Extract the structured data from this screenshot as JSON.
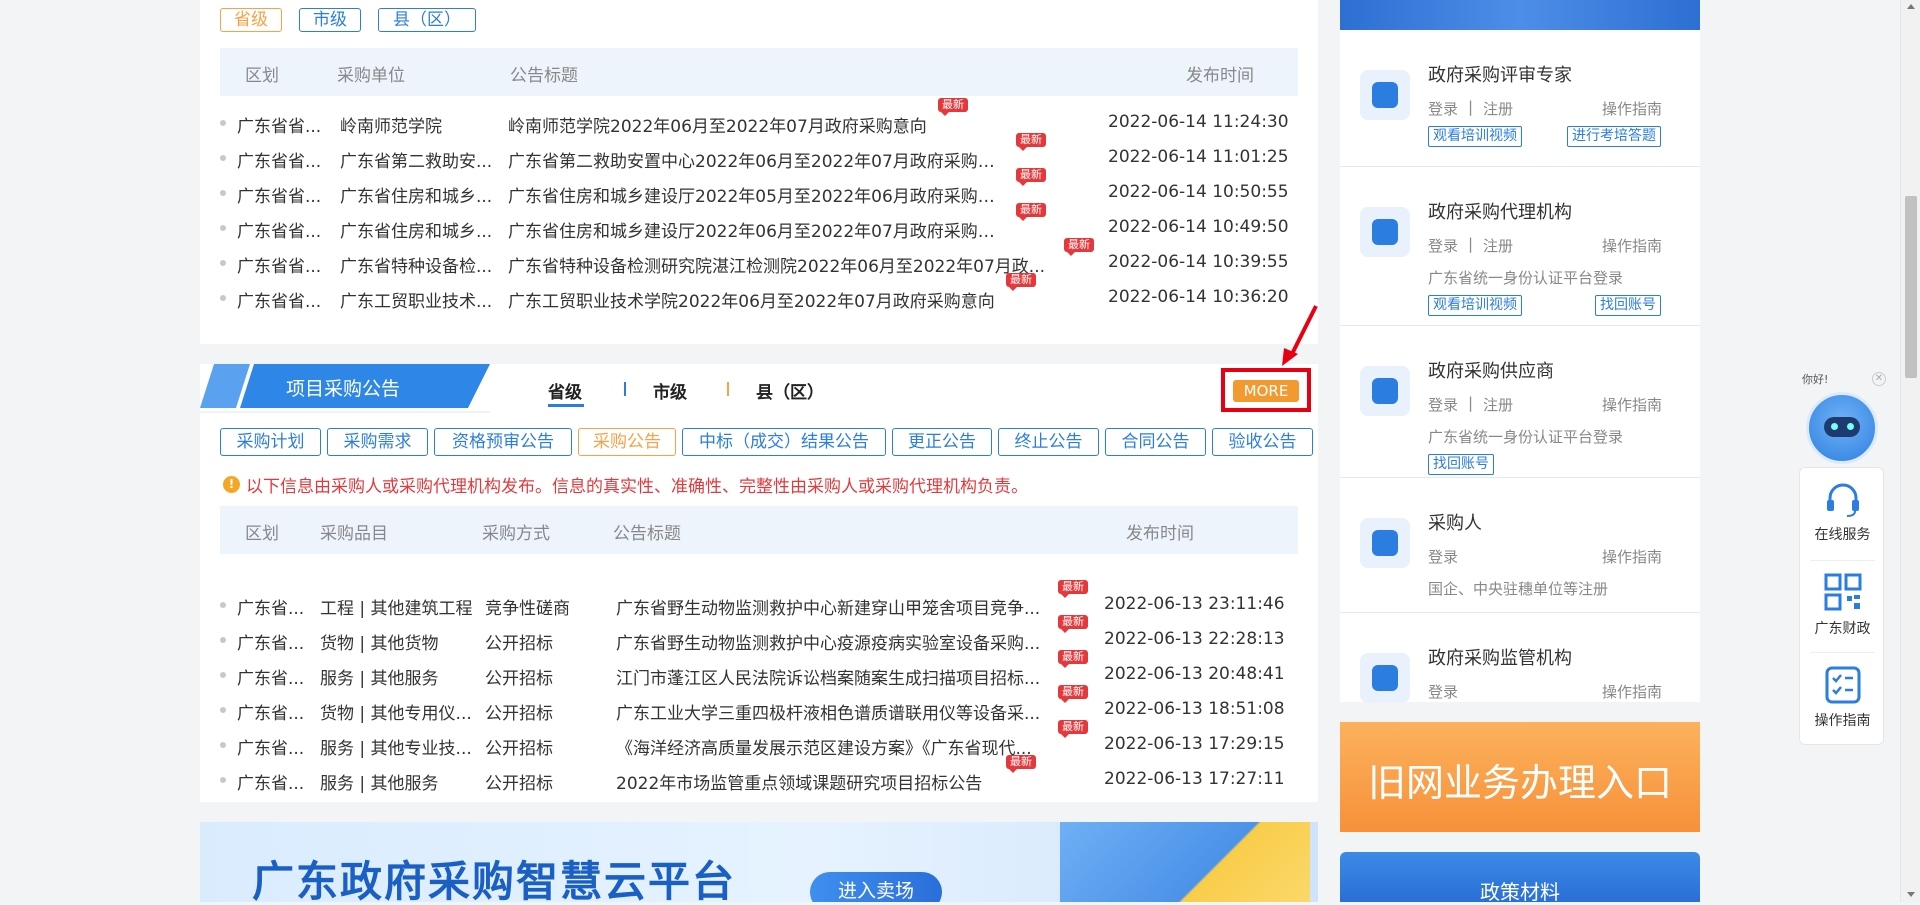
{
  "top_section": {
    "level_tabs": [
      "省级",
      "市级",
      "县（区）"
    ],
    "headers": [
      "区划",
      "采购单位",
      "公告标题",
      "发布时间"
    ],
    "rows": [
      {
        "region": "广东省省...",
        "unit": "岭南师范学院",
        "title": "岭南师范学院2022年06月至2022年07月政府采购意向",
        "badge": "最新",
        "time": "2022-06-14 11:24:30"
      },
      {
        "region": "广东省省...",
        "unit": "广东省第二救助安...",
        "title": "广东省第二救助安置中心2022年06月至2022年07月政府采购意向",
        "badge": "最新",
        "time": "2022-06-14 11:01:25"
      },
      {
        "region": "广东省省...",
        "unit": "广东省住房和城乡...",
        "title": "广东省住房和城乡建设厅2022年05月至2022年06月政府采购意向",
        "badge": "最新",
        "time": "2022-06-14 10:50:55"
      },
      {
        "region": "广东省省...",
        "unit": "广东省住房和城乡...",
        "title": "广东省住房和城乡建设厅2022年06月至2022年07月政府采购意向",
        "badge": "最新",
        "time": "2022-06-14 10:49:50"
      },
      {
        "region": "广东省省...",
        "unit": "广东省特种设备检...",
        "title": "广东省特种设备检测研究院湛江检测院2022年06月至2022年07月政...",
        "badge": "最新",
        "time": "2022-06-14 10:39:55"
      },
      {
        "region": "广东省省...",
        "unit": "广东工贸职业技术...",
        "title": "广东工贸职业技术学院2022年06月至2022年07月政府采购意向",
        "badge": "最新",
        "time": "2022-06-14 10:36:20"
      }
    ]
  },
  "project_section": {
    "title": "项目采购公告",
    "level_tabs": [
      "省级",
      "市级",
      "县（区）"
    ],
    "more_label": "MORE",
    "type_tabs": [
      "采购计划",
      "采购需求",
      "资格预审公告",
      "采购公告",
      "中标（成交）结果公告",
      "更正公告",
      "终止公告",
      "合同公告",
      "验收公告"
    ],
    "notice": "以下信息由采购人或采购代理机构发布。信息的真实性、准确性、完整性由采购人或采购代理机构负责。",
    "headers": [
      "区划",
      "采购品目",
      "采购方式",
      "公告标题",
      "发布时间"
    ],
    "rows": [
      {
        "region": "广东省...",
        "item": "工程 | 其他建筑工程",
        "method": "竞争性磋商",
        "title": "广东省野生动物监测救护中心新建穿山甲笼舍项目竞争...",
        "badge": "最新",
        "time": "2022-06-13 23:11:46"
      },
      {
        "region": "广东省...",
        "item": "货物 | 其他货物",
        "method": "公开招标",
        "title": "广东省野生动物监测救护中心疫源疫病实验室设备采购...",
        "badge": "最新",
        "time": "2022-06-13 22:28:13"
      },
      {
        "region": "广东省...",
        "item": "服务 | 其他服务",
        "method": "公开招标",
        "title": "江门市蓬江区人民法院诉讼档案随案生成扫描项目招标...",
        "badge": "最新",
        "time": "2022-06-13 20:48:41"
      },
      {
        "region": "广东省...",
        "item": "货物 | 其他专用仪...",
        "method": "公开招标",
        "title": "广东工业大学三重四极杆液相色谱质谱联用仪等设备采...",
        "badge": "最新",
        "time": "2022-06-13 18:51:08"
      },
      {
        "region": "广东省...",
        "item": "服务 | 其他专业技...",
        "method": "公开招标",
        "title": "《海洋经济高质量发展示范区建设方案》《广东省现代...",
        "badge": "最新",
        "time": "2022-06-13 17:29:15"
      },
      {
        "region": "广东省...",
        "item": "服务 | 其他服务",
        "method": "公开招标",
        "title": "2022年市场监管重点领域课题研究项目招标公告",
        "badge": "最新",
        "time": "2022-06-13 17:27:11"
      }
    ]
  },
  "banner": {
    "title": "广东政府采购智慧云平台",
    "button": "进入卖场"
  },
  "sidebar": {
    "cards": [
      {
        "title": "政府采购评审专家",
        "login": "登录",
        "register": "注册",
        "guide": "操作指南",
        "note": "",
        "buttons": [
          "观看培训视频",
          "进行考培答题"
        ]
      },
      {
        "title": "政府采购代理机构",
        "login": "登录",
        "register": "注册",
        "guide": "操作指南",
        "note": "广东省统一身份认证平台登录",
        "buttons": [
          "观看培训视频",
          "找回账号"
        ]
      },
      {
        "title": "政府采购供应商",
        "login": "登录",
        "register": "注册",
        "guide": "操作指南",
        "note": "广东省统一身份认证平台登录",
        "buttons": [
          "找回账号"
        ]
      },
      {
        "title": "采购人",
        "login": "登录",
        "register": "",
        "guide": "操作指南",
        "note": "国企、中央驻穗单位等注册",
        "buttons": []
      },
      {
        "title": "政府采购监管机构",
        "login": "登录",
        "register": "",
        "guide": "操作指南",
        "note": "",
        "buttons": []
      }
    ],
    "old_portal": "旧网业务办理入口",
    "policy": "政策材料"
  },
  "float_bar": {
    "greeting": "你好!",
    "items": [
      "在线服务",
      "广东财政",
      "操作指南"
    ]
  },
  "colors": {
    "accent": "#2b7de0",
    "orange": "#f7a246",
    "badge_red": "#e4393c",
    "highlight_red": "#e60012"
  }
}
